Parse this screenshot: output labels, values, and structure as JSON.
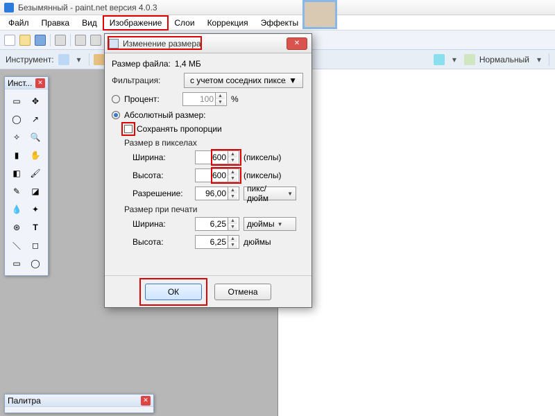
{
  "titlebar": {
    "text": "Безымянный - paint.net версия 4.0.3"
  },
  "menu": {
    "file": "Файл",
    "edit": "Правка",
    "view": "Вид",
    "image": "Изображение",
    "layers": "Слои",
    "adjust": "Коррекция",
    "effects": "Эффекты"
  },
  "toolrow": {
    "label": "Инструмент:",
    "blend_label": "Нормальный"
  },
  "toolbox": {
    "title": "Инст..."
  },
  "palette": {
    "title": "Палитра"
  },
  "dialog": {
    "title": "Изменение размера",
    "filesize_label": "Размер файла:",
    "filesize_value": "1,4 МБ",
    "filter_label": "Фильтрация:",
    "filter_value": "с учетом соседних пикселов",
    "percent_label": "Процент:",
    "percent_value": "100",
    "percent_unit": "%",
    "absolute_label": "Абсолютный размер:",
    "keep_ratio": "Сохранять пропорции",
    "pixel_group": "Размер в пикселах",
    "width_label": "Ширина:",
    "height_label": "Высота:",
    "width_value": "600",
    "height_value": "600",
    "px_unit": "(пикселы)",
    "resolution_label": "Разрешение:",
    "resolution_value": "96,00",
    "resolution_unit": "пикс/дюйм",
    "print_group": "Размер при печати",
    "print_width": "6,25",
    "print_height": "6,25",
    "print_unit": "дюймы",
    "ok": "ОК",
    "cancel": "Отмена"
  }
}
